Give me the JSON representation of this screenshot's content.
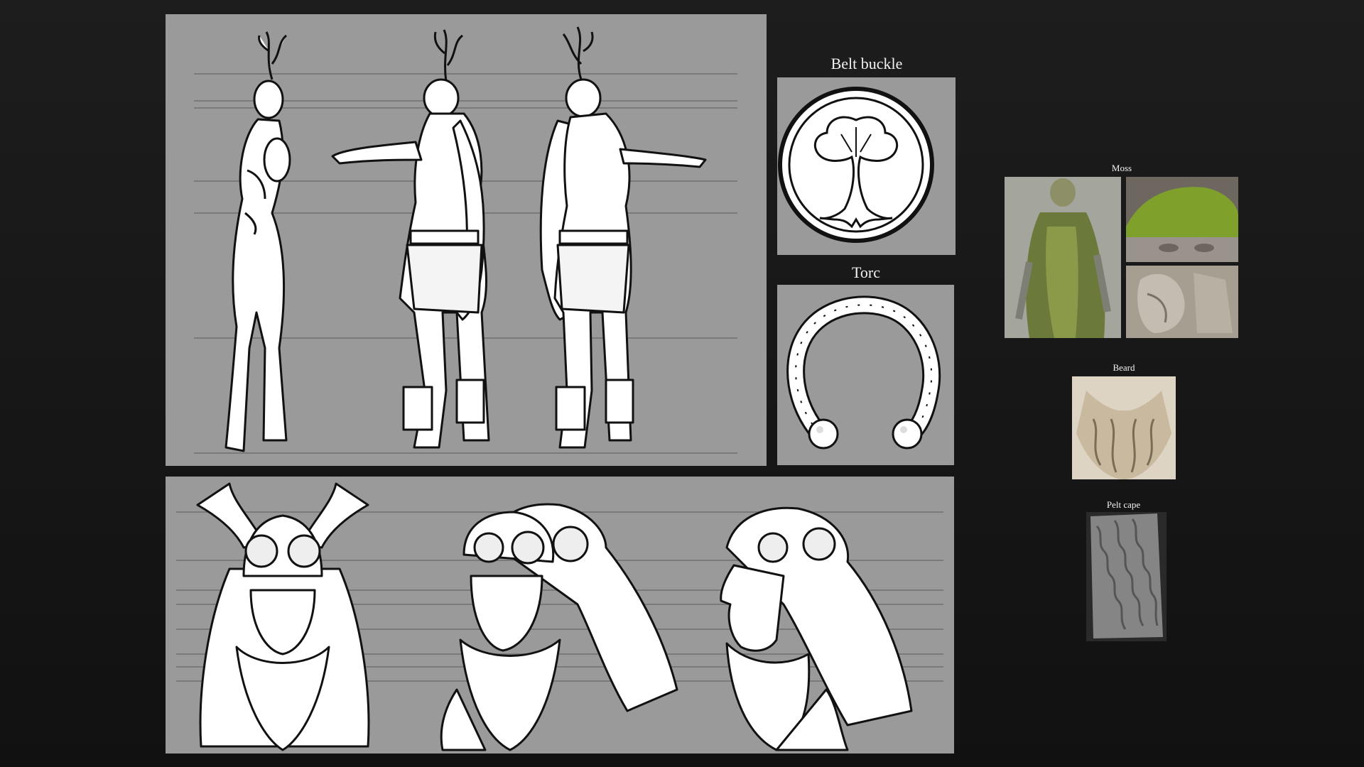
{
  "sheet": {
    "background": "#161616",
    "panel_color": "#9a9a9a"
  },
  "props": {
    "belt_buckle": {
      "title": "Belt buckle",
      "icon": "tree-emblem-icon"
    },
    "torc": {
      "title": "Torc",
      "icon": "twisted-torc-icon"
    }
  },
  "references": {
    "moss": {
      "label": "Moss"
    },
    "beard": {
      "label": "Beard"
    },
    "pelt_cape": {
      "label": "Pelt cape"
    }
  }
}
